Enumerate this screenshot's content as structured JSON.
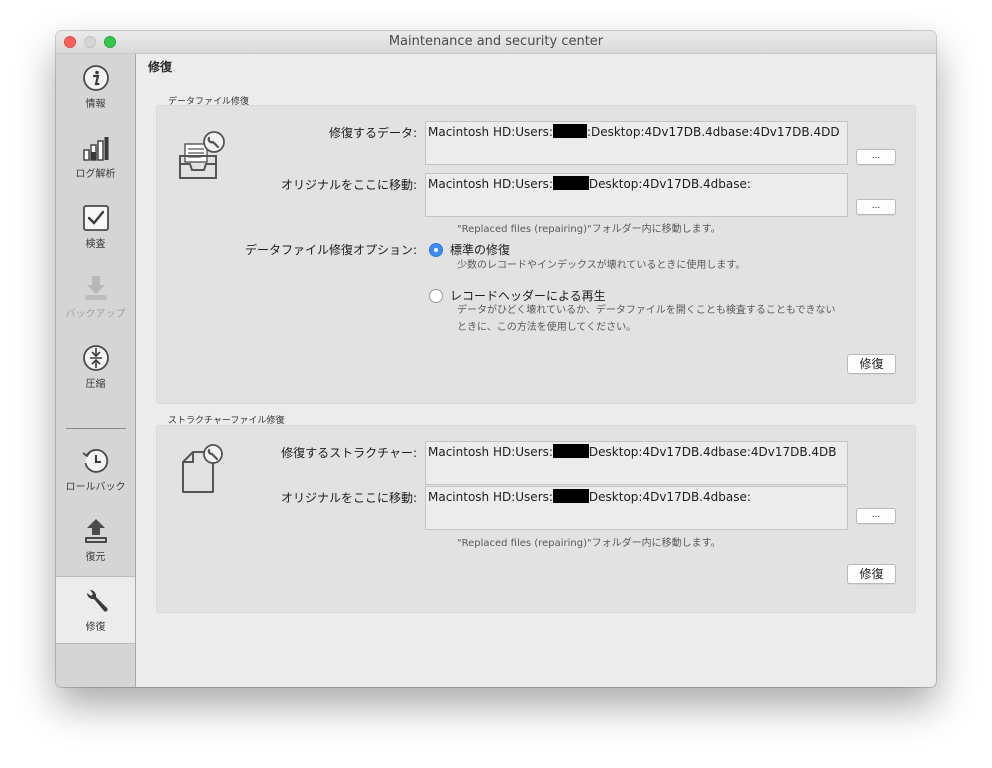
{
  "window": {
    "title": "Maintenance and security center"
  },
  "sidebar": {
    "items": [
      {
        "label": "情報",
        "icon": "info-icon"
      },
      {
        "label": "ログ解析",
        "icon": "bar-chart-icon"
      },
      {
        "label": "検査",
        "icon": "checkbox-icon"
      },
      {
        "label": "バックアップ",
        "icon": "download-icon",
        "disabled": true
      },
      {
        "label": "圧縮",
        "icon": "compress-icon"
      },
      {
        "label": "ロールバック",
        "icon": "history-icon"
      },
      {
        "label": "復元",
        "icon": "upload-icon"
      },
      {
        "label": "修復",
        "icon": "wrench-icon",
        "active": true
      }
    ]
  },
  "page": {
    "title": "修復"
  },
  "data_repair": {
    "section_label": "データファイル修復",
    "icon": "inbox-tray-wrench-icon",
    "repair_data_label": "修復するデータ:",
    "repair_data_before": "Macintosh HD:Users:",
    "repair_data_after": ":Desktop:4Dv17DB.4dbase:4Dv17DB.4DD",
    "original_label": "オリジナルをここに移動:",
    "original_before": "Macintosh HD:Users:",
    "original_after": "Desktop:4Dv17DB.4dbase:",
    "browse_label": "...",
    "move_hint": "\"Replaced files (repairing)\"フォルダー内に移動します。",
    "options_label": "データファイル修復オプション:",
    "option_standard_label": "標準の修復",
    "option_standard_desc": "少数のレコードやインデックスが壊れているときに使用します。",
    "option_header_label": "レコードヘッダーによる再生",
    "option_header_desc1": "データがひどく壊れているか、データファイルを開くことも検査することもできない",
    "option_header_desc2": "ときに、この方法を使用してください。",
    "selected_option": "standard",
    "repair_button": "修復"
  },
  "structure_repair": {
    "section_label": "ストラクチャーファイル修復",
    "icon": "document-wrench-icon",
    "repair_structure_label": "修復するストラクチャー:",
    "repair_structure_before": "Macintosh HD:Users:",
    "repair_structure_after": "Desktop:4Dv17DB.4dbase:4Dv17DB.4DB",
    "original_label": "オリジナルをここに移動:",
    "original_before": "Macintosh HD:Users:",
    "original_after": "Desktop:4Dv17DB.4dbase:",
    "browse_label": "...",
    "move_hint": "\"Replaced files (repairing)\"フォルダー内に移動します。",
    "repair_button": "修復"
  },
  "colors": {
    "accent": "#3b8bf5",
    "redaction": "#000000"
  }
}
